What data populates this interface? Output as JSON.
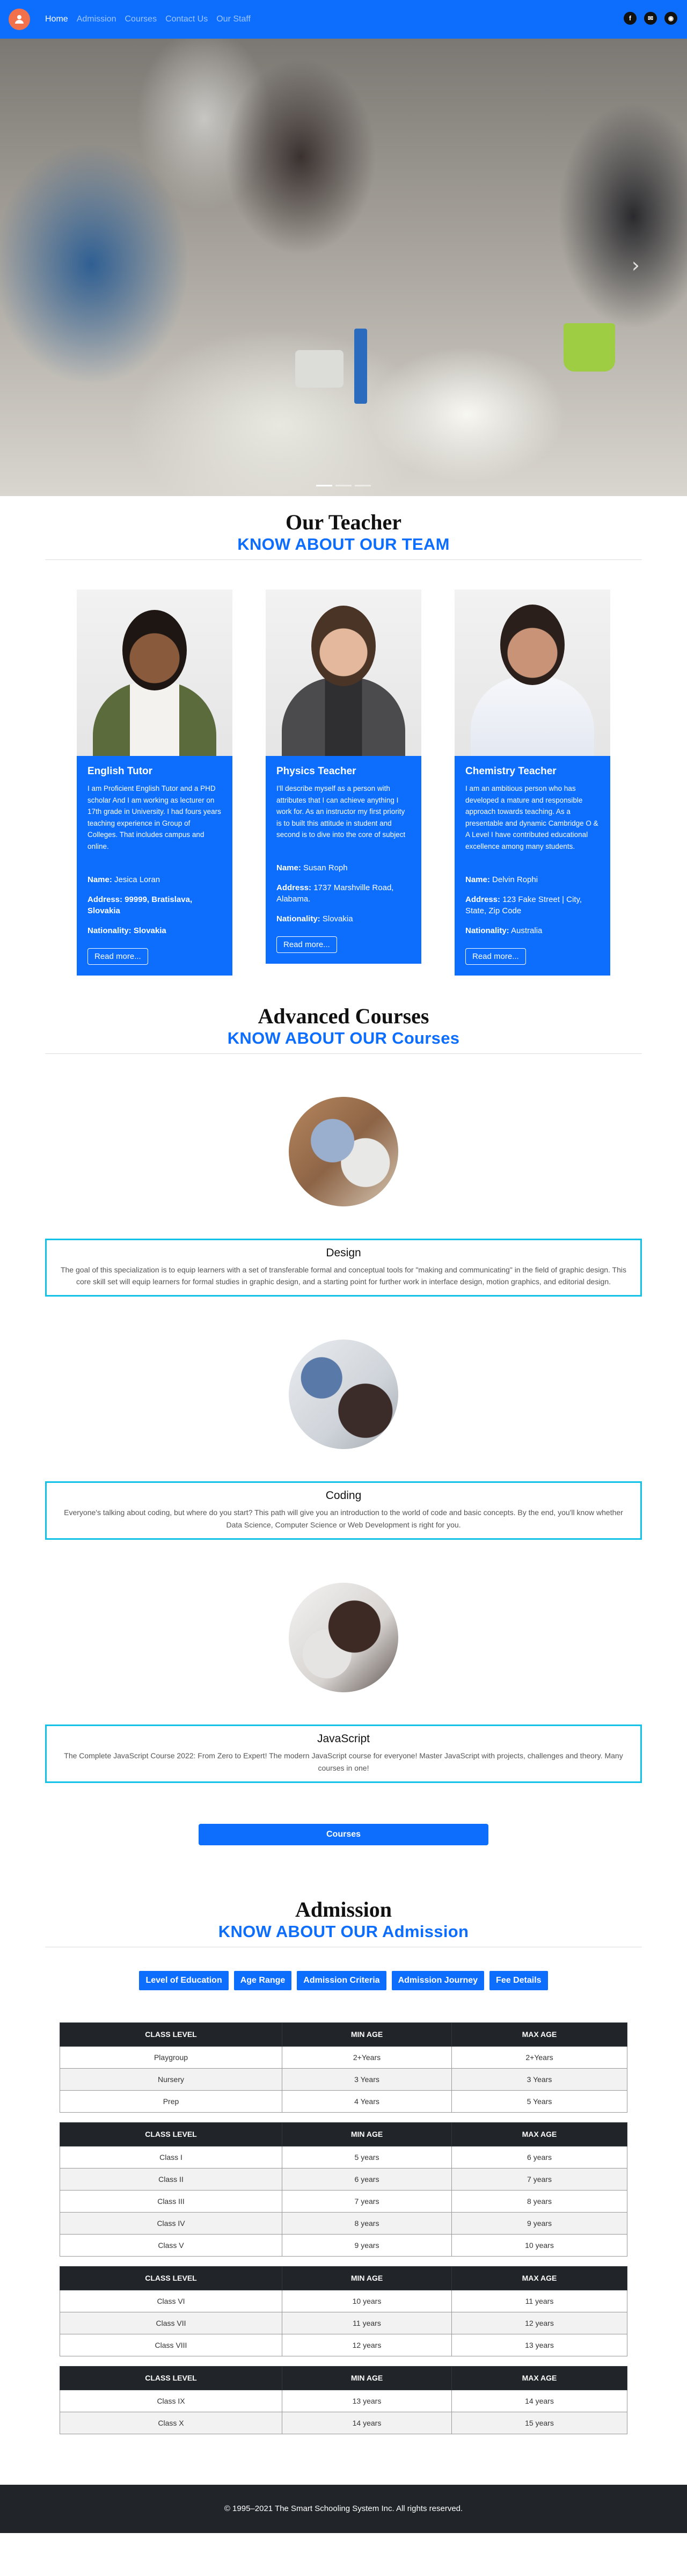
{
  "nav": {
    "links": [
      "Home",
      "Admission",
      "Courses",
      "Contact Us",
      "Our Staff"
    ],
    "social": [
      "facebook-icon",
      "email-icon",
      "github-icon"
    ]
  },
  "teachers": {
    "title": "Our Teacher",
    "subtitle": "KNOW ABOUT OUR TEAM",
    "cards": [
      {
        "role": "English Tutor",
        "desc": "I am Proficient English Tutor and a PHD scholar And I am working as lecturer on 17th grade in University. I had fours years teaching experience in Group of Colleges. That includes campus and online.",
        "name_label": "Name:",
        "name": "Jesica Loran",
        "address_label": "Address:",
        "address": "99999, Bratislava, Slovakia",
        "nationality_label": "Nationality:",
        "nationality": "Slovakia",
        "button": "Read more..."
      },
      {
        "role": "Physics Teacher",
        "desc": "I'll describe myself as a person with attributes that I can achieve anything I work for. As an instructor my first priority is to built this attitude in student and second is to dive into the core of subject",
        "name_label": "Name:",
        "name": "Susan Roph",
        "address_label": "Address:",
        "address": "1737 Marshville Road, Alabama.",
        "nationality_label": "Nationality:",
        "nationality": "Slovakia",
        "button": "Read more..."
      },
      {
        "role": "Chemistry Teacher",
        "desc": "I am an ambitious person who has developed a mature and responsible approach towards teaching. As a presentable and dynamic Cambridge O & A Level I have contributed educational excellence among many students.",
        "name_label": "Name:",
        "name": "Delvin Rophi",
        "address_label": "Address:",
        "address": "123 Fake Street | City, State, Zip Code",
        "nationality_label": "Nationality:",
        "nationality": "Australia",
        "button": "Read more..."
      }
    ]
  },
  "courses": {
    "title": "Advanced Courses",
    "subtitle": "KNOW ABOUT OUR Courses",
    "items": [
      {
        "name": "Design",
        "desc": "The goal of this specialization is to equip learners with a set of transferable formal and conceptual tools for \"making and communicating\" in the field of graphic design. This core skill set will equip learners for formal studies in graphic design, and a starting point for further work in interface design, motion graphics, and editorial design."
      },
      {
        "name": "Coding",
        "desc": "Everyone's talking about coding, but where do you start? This path will give you an introduction to the world of code and basic concepts. By the end, you'll know whether Data Science, Computer Science or Web Development is right for you."
      },
      {
        "name": "JavaScript",
        "desc": "The Complete JavaScript Course 2022: From Zero to Expert! The modern JavaScript course for everyone! Master JavaScript with projects, challenges and theory. Many courses in one!"
      }
    ],
    "button": "Courses"
  },
  "admission": {
    "title": "Admission",
    "subtitle": "KNOW ABOUT OUR Admission",
    "tabs": [
      "Level of Education",
      "Age Range",
      "Admission Criteria",
      "Admission Journey",
      "Fee Details"
    ],
    "headers": [
      "CLASS LEVEL",
      "MIN AGE",
      "MAX AGE"
    ],
    "tables": [
      [
        [
          "Playgroup",
          "2+Years",
          "2+Years"
        ],
        [
          "Nursery",
          "3 Years",
          "3 Years"
        ],
        [
          "Prep",
          "4 Years",
          "5 Years"
        ]
      ],
      [
        [
          "Class I",
          "5 years",
          "6 years"
        ],
        [
          "Class II",
          "6 years",
          "7 years"
        ],
        [
          "Class III",
          "7 years",
          "8 years"
        ],
        [
          "Class IV",
          "8 years",
          "9 years"
        ],
        [
          "Class V",
          "9 years",
          "10 years"
        ]
      ],
      [
        [
          "Class VI",
          "10 years",
          "11 years"
        ],
        [
          "Class VII",
          "11 years",
          "12 years"
        ],
        [
          "Class VIII",
          "12 years",
          "13 years"
        ]
      ],
      [
        [
          "Class IX",
          "13 years",
          "14 years"
        ],
        [
          "Class X",
          "14 years",
          "15 years"
        ]
      ]
    ]
  },
  "footer": {
    "text": "© 1995–2021 The Smart Schooling System Inc. All rights reserved."
  }
}
